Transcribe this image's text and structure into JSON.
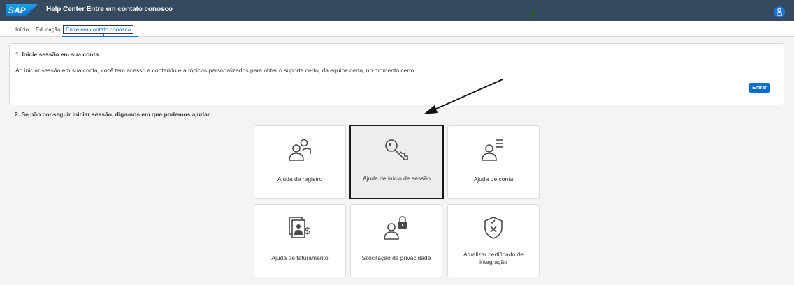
{
  "header": {
    "logo_text": "SAP",
    "title": "Help Center Entre em contato conosco",
    "user_icon": "user-icon"
  },
  "nav": {
    "items": [
      {
        "label": "Início"
      },
      {
        "label": "Educação"
      },
      {
        "label": "Entre em contato conosco"
      }
    ]
  },
  "signin": {
    "title": "1. Inicie sessão em sua conta.",
    "description": "Ao iniciar sessão em sua conta, você tem acesso a conteúdo e a tópicos personalizados para obter o suporte certo, da equipe certa, no momento certo.",
    "button_label": "Entrar"
  },
  "help": {
    "title": "2. Se não conseguir iniciar sessão, diga-nos em que podemos ajudar.",
    "tiles": [
      {
        "label": "Ajuda de registro",
        "icon": "users-icon"
      },
      {
        "label": "Ajuda de início de sessão",
        "icon": "key-icon",
        "selected": true
      },
      {
        "label": "Ajuda de conta",
        "icon": "user-list-icon"
      },
      {
        "label": "Ajuda de faturamento",
        "icon": "billing-document-icon"
      },
      {
        "label": "Solicitação de privacidade",
        "icon": "user-lock-icon"
      },
      {
        "label": "Atualizar certificado de integração",
        "icon": "shield-certificate-icon"
      }
    ]
  },
  "colors": {
    "shellbar": "#354a5f",
    "accent": "#0a6ed1",
    "background": "#f3f4f5"
  }
}
